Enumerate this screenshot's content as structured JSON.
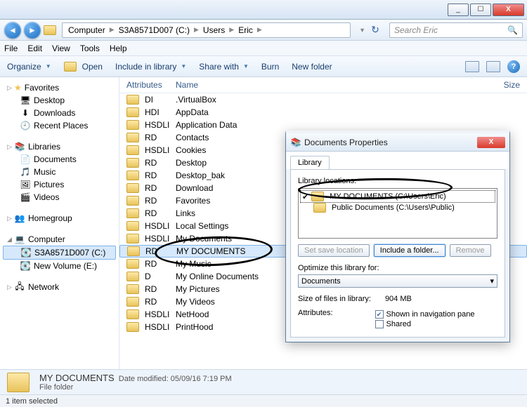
{
  "window": {
    "min": "_",
    "max": "☐",
    "close": "X"
  },
  "breadcrumb": [
    "Computer",
    "S3A8571D007 (C:)",
    "Users",
    "Eric"
  ],
  "search_placeholder": "Search Eric",
  "menus": {
    "file": "File",
    "edit": "Edit",
    "view": "View",
    "tools": "Tools",
    "help": "Help"
  },
  "toolbar": {
    "organize": "Organize",
    "open": "Open",
    "include": "Include in library",
    "share": "Share with",
    "burn": "Burn",
    "newfolder": "New folder"
  },
  "sidebar": {
    "favorites": {
      "title": "Favorites",
      "items": [
        "Desktop",
        "Downloads",
        "Recent Places"
      ]
    },
    "libraries": {
      "title": "Libraries",
      "items": [
        "Documents",
        "Music",
        "Pictures",
        "Videos"
      ]
    },
    "homegroup": {
      "title": "Homegroup"
    },
    "computer": {
      "title": "Computer",
      "items": [
        "S3A8571D007 (C:)",
        "New Volume (E:)"
      ]
    },
    "network": {
      "title": "Network"
    }
  },
  "columns": {
    "attr": "Attributes",
    "name": "Name",
    "size": "Size"
  },
  "rows": [
    {
      "attr": "DI",
      "name": ".VirtualBox"
    },
    {
      "attr": "HDI",
      "name": "AppData"
    },
    {
      "attr": "HSDLI",
      "name": "Application Data"
    },
    {
      "attr": "RD",
      "name": "Contacts"
    },
    {
      "attr": "HSDLI",
      "name": "Cookies"
    },
    {
      "attr": "RD",
      "name": "Desktop"
    },
    {
      "attr": "RD",
      "name": "Desktop_bak"
    },
    {
      "attr": "RD",
      "name": "Download"
    },
    {
      "attr": "RD",
      "name": "Favorites"
    },
    {
      "attr": "RD",
      "name": "Links"
    },
    {
      "attr": "HSDLI",
      "name": "Local Settings"
    },
    {
      "attr": "HSDLI",
      "name": "My Documents"
    },
    {
      "attr": "RD",
      "name": "MY DOCUMENTS",
      "selected": true
    },
    {
      "attr": "RD",
      "name": "My Music"
    },
    {
      "attr": "D",
      "name": "My Online Documents"
    },
    {
      "attr": "RD",
      "name": "My Pictures"
    },
    {
      "attr": "RD",
      "name": "My Videos"
    },
    {
      "attr": "HSDLI",
      "name": "NetHood"
    },
    {
      "attr": "HSDLI",
      "name": "PrintHood"
    }
  ],
  "details": {
    "name": "MY DOCUMENTS",
    "type": "File folder",
    "modlabel": "Date modified:",
    "modified": "05/09/16 7:19 PM"
  },
  "status": "1 item selected",
  "props": {
    "title": "Documents Properties",
    "tab": "Library",
    "loc_label": "Library locations:",
    "locations": [
      {
        "text": "MY DOCUMENTS (C:\\Users\\Eric)",
        "selected": true,
        "check": true
      },
      {
        "text": "Public Documents (C:\\Users\\Public)"
      }
    ],
    "btn_set": "Set save location",
    "btn_inc": "Include a folder...",
    "btn_rem": "Remove",
    "opt_label": "Optimize this library for:",
    "opt_value": "Documents",
    "size_label": "Size of files in library:",
    "size_value": "904 MB",
    "attr_label": "Attributes:",
    "chk_nav": "Shown in navigation pane",
    "chk_shared": "Shared"
  }
}
